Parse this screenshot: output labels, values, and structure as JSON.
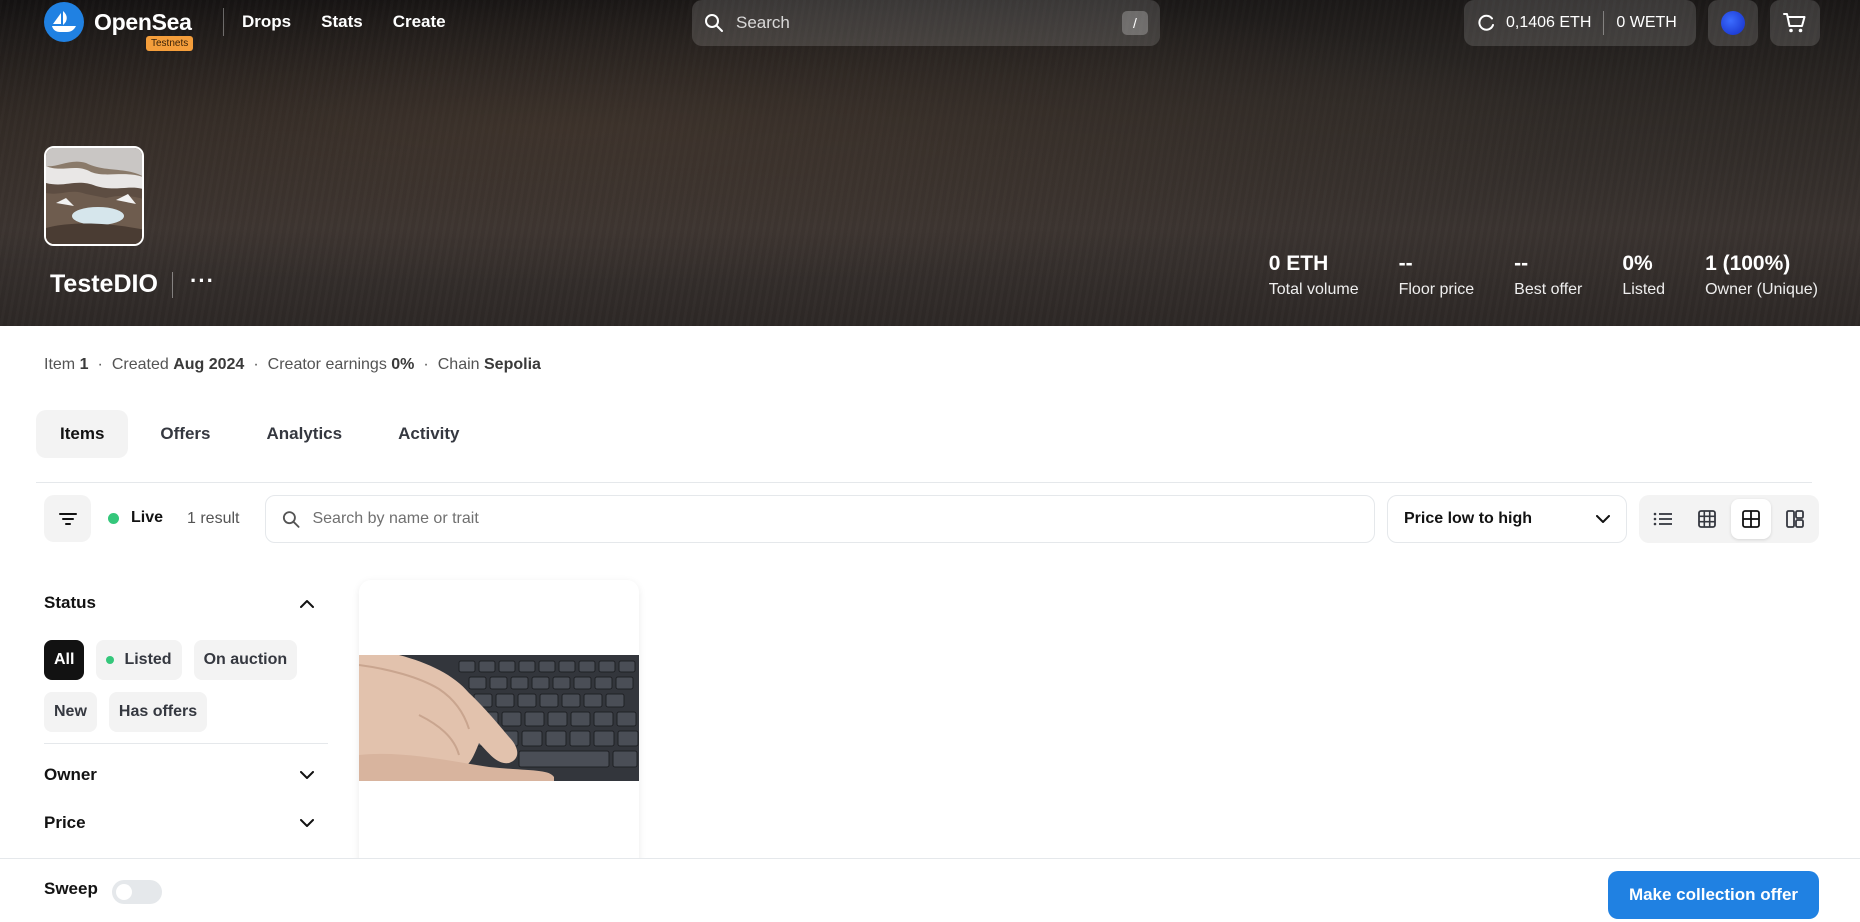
{
  "nav": {
    "brand": "OpenSea",
    "badge": "Testnets",
    "links": [
      "Drops",
      "Stats",
      "Create"
    ],
    "search_placeholder": "Search",
    "search_shortcut": "/",
    "wallet": {
      "eth": "0,1406 ETH",
      "weth": "0 WETH"
    }
  },
  "collection": {
    "name": "TesteDIO",
    "more": "···",
    "stats": [
      {
        "value": "0 ETH",
        "label": "Total volume"
      },
      {
        "value": "--",
        "label": "Floor price"
      },
      {
        "value": "--",
        "label": "Best offer"
      },
      {
        "value": "0%",
        "label": "Listed"
      },
      {
        "value": "1 (100%)",
        "label": "Owner (Unique)"
      }
    ],
    "info": {
      "item_label": "Item",
      "item_value": "1",
      "created_label": "Created",
      "created_value": "Aug 2024",
      "earnings_label": "Creator earnings",
      "earnings_value": "0%",
      "chain_label": "Chain",
      "chain_value": "Sepolia",
      "dot": "·"
    }
  },
  "tabs": [
    "Items",
    "Offers",
    "Analytics",
    "Activity"
  ],
  "toolbar": {
    "live": "Live",
    "results": "1 result",
    "search_placeholder": "Search by name or trait",
    "sort": "Price low to high"
  },
  "sidebar": {
    "status_title": "Status",
    "chips": [
      "All",
      "Listed",
      "On auction",
      "New",
      "Has offers"
    ],
    "owner_title": "Owner",
    "price_title": "Price"
  },
  "footer": {
    "sweep": "Sweep",
    "offer_button": "Make collection offer"
  },
  "colors": {
    "accent": "#2081e2",
    "live": "#34c77b",
    "badge": "#f59e3b"
  }
}
